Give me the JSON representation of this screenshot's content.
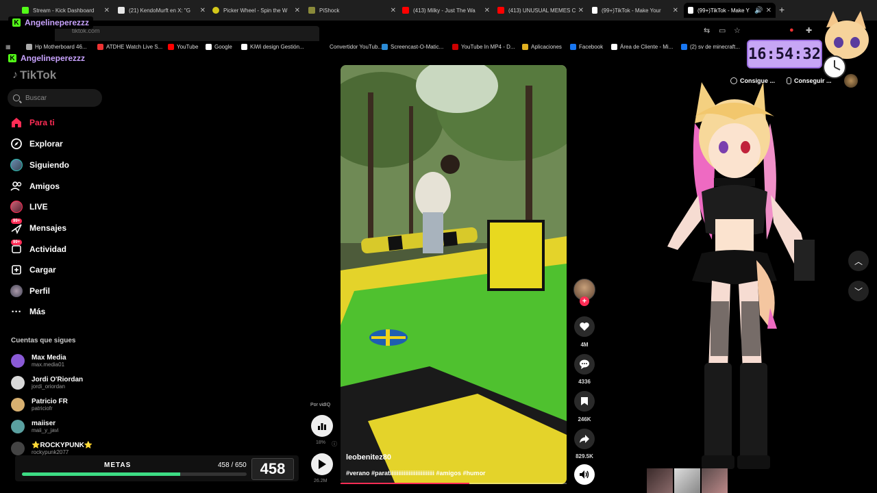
{
  "browser": {
    "tabs": [
      {
        "title": "Stream - Kick Dashboard",
        "favicon_color": "#53fc18",
        "active": false
      },
      {
        "title": "(21) KendoMurft en X: \"G",
        "favicon_color": "#e7e7e7",
        "active": false
      },
      {
        "title": "Picker Wheel - Spin the W",
        "favicon_color": "#d4c81a",
        "active": false
      },
      {
        "title": "PiShock",
        "favicon_color": "#8a8a3a",
        "active": false
      },
      {
        "title": "(413) Milky - Just The Wa",
        "favicon_color": "#ff0000",
        "active": false
      },
      {
        "title": "(413) UNUSUAL MEMES C",
        "favicon_color": "#ff0000",
        "active": false
      },
      {
        "title": "(99+)TikTok - Make Your",
        "favicon_color": "#ffffff",
        "active": false
      },
      {
        "title": "(99+)TikTok - Make Y",
        "favicon_color": "#ffffff",
        "active": true
      }
    ],
    "url": "tiktok.com",
    "bookmarks": [
      {
        "label": "Hp Motherboard 46...",
        "color": "#aaaaaa"
      },
      {
        "label": "ATDHE Watch Live S...",
        "color": "#e33"
      },
      {
        "label": "YouTube",
        "color": "#ff0000"
      },
      {
        "label": "Google",
        "color": "#ffffff"
      },
      {
        "label": "KiWi design Gestión...",
        "color": "#ffffff"
      },
      {
        "label": "Convertidor YouTub...",
        "color": "#000000"
      },
      {
        "label": "Screencast-O-Matic...",
        "color": "#2b8bd6"
      },
      {
        "label": "YouTube In MP4 - D...",
        "color": "#cc0000"
      },
      {
        "label": "Aplicaciones",
        "color": "#e0b020"
      },
      {
        "label": "Facebook",
        "color": "#1877f2"
      },
      {
        "label": "Área de Cliente - Mi...",
        "color": "#ffffff"
      },
      {
        "label": "(2) sv de minecraft...",
        "color": "#1877f2"
      }
    ]
  },
  "overlay": {
    "kick_user_1": "Angelineperezzz",
    "kick_user_2": "Angelineperezzz",
    "clock": "16:54:32"
  },
  "tiktok": {
    "logo": "TikTok",
    "search_placeholder": "Buscar",
    "nav": [
      {
        "label": "Para ti",
        "icon": "home-icon",
        "active": true
      },
      {
        "label": "Explorar",
        "icon": "compass-icon"
      },
      {
        "label": "Siguiendo",
        "icon": "following-avatar"
      },
      {
        "label": "Amigos",
        "icon": "friends-icon"
      },
      {
        "label": "LIVE",
        "icon": "live-icon"
      },
      {
        "label": "Mensajes",
        "icon": "messages-icon",
        "badge": "99+"
      },
      {
        "label": "Actividad",
        "icon": "activity-icon",
        "badge": "99+"
      },
      {
        "label": "Cargar",
        "icon": "upload-icon"
      },
      {
        "label": "Perfil",
        "icon": "profile-avatar"
      },
      {
        "label": "Más",
        "icon": "more-icon"
      }
    ],
    "following_title": "Cuentas que sigues",
    "following": [
      {
        "name": "Max Media",
        "handle": "max.media01",
        "color": "#8a5ad6"
      },
      {
        "name": "Jordi O'Riordan",
        "handle": "jordi_oriordan",
        "color": "#d9d9d9"
      },
      {
        "name": "Patricio FR",
        "handle": "patriciofr",
        "color": "#d8b070"
      },
      {
        "name": "maiiser",
        "handle": "maii_y_javi",
        "color": "#5aa0a0"
      },
      {
        "name": "⭐ROCKYPUNK⭐",
        "handle": "rockypunk2077",
        "color": "#444444"
      }
    ],
    "get_buttons": [
      "Consigue ...",
      "Conseguir ..."
    ]
  },
  "metas": {
    "label": "METAS",
    "count": "458 / 650",
    "current": 458,
    "goal": 650,
    "big": "458"
  },
  "video": {
    "author": "leobenitez80",
    "tags": "#verano #paratiiiiiiiiiiiiiiiiiiiiiiiiii #amigos #humor",
    "progress": 0.57,
    "vidiq_label": "Por vidIQ",
    "vidiq_pct": "18%",
    "views": "26.2M"
  },
  "actions": {
    "likes": "4M",
    "comments": "4336",
    "saves": "246K",
    "shares": "829.5K"
  }
}
